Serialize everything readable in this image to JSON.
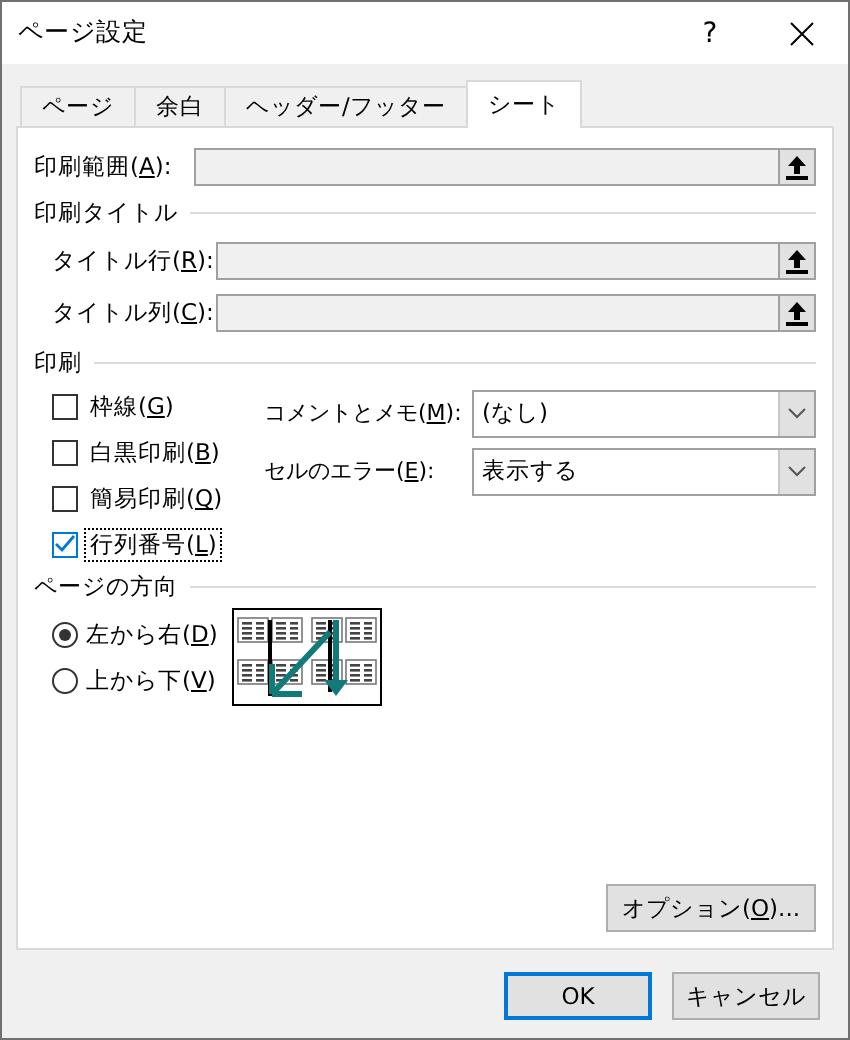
{
  "window": {
    "title": "ページ設定",
    "help": "?"
  },
  "tabs": [
    {
      "label": "ページ",
      "selected": false
    },
    {
      "label": "余白",
      "selected": false
    },
    {
      "label": "ヘッダー/フッター",
      "selected": false
    },
    {
      "label": "シート",
      "selected": true
    }
  ],
  "print_area": {
    "label": "印刷範囲(",
    "access_key": "A",
    "label_end": "):"
  },
  "print_titles": {
    "heading": "印刷タイトル",
    "fields": [
      {
        "label": "タイトル行(",
        "access_key": "R",
        "label_end": "):"
      },
      {
        "label": "タイトル列(",
        "access_key": "C",
        "label_end": "):"
      }
    ]
  },
  "print": {
    "heading": "印刷",
    "checkboxes": [
      {
        "label": "枠線(",
        "access_key": "G",
        "label_end": ")",
        "checked": false,
        "focused": false
      },
      {
        "label": "白黒印刷(",
        "access_key": "B",
        "label_end": ")",
        "checked": false,
        "focused": false
      },
      {
        "label": "簡易印刷(",
        "access_key": "Q",
        "label_end": ")",
        "checked": false,
        "focused": false
      },
      {
        "label": "行列番号(",
        "access_key": "L",
        "label_end": ")",
        "checked": true,
        "focused": true
      }
    ],
    "dropdowns": [
      {
        "label": "コメントとメモ(",
        "access_key": "M",
        "label_end": "):",
        "value": "(なし)"
      },
      {
        "label": "セルのエラー(",
        "access_key": "E",
        "label_end": "):",
        "value": "表示する"
      }
    ]
  },
  "page_order": {
    "heading": "ページの方向",
    "options": [
      {
        "label": "左から右(",
        "access_key": "D",
        "label_end": ")",
        "selected": true
      },
      {
        "label": "上から下(",
        "access_key": "V",
        "label_end": ")",
        "selected": false
      }
    ]
  },
  "options_button": {
    "label": "オプション(",
    "access_key": "O",
    "label_end": ")..."
  },
  "buttons": [
    {
      "label": "OK",
      "default": true
    },
    {
      "label": "キャンセル",
      "default": false
    }
  ]
}
